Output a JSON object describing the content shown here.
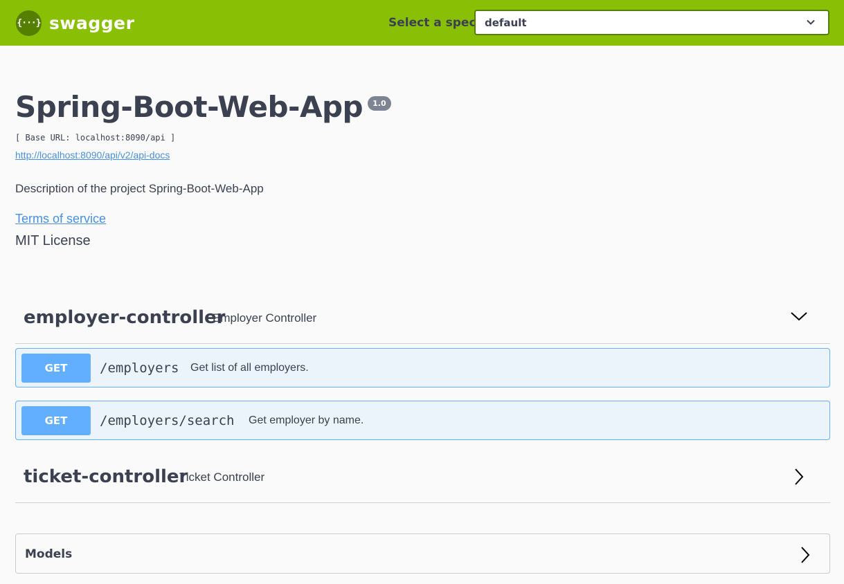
{
  "topbar": {
    "logo_glyph": "{···}",
    "logo_text": "swagger",
    "spec_label": "Select a spec",
    "spec_selected": "default"
  },
  "info": {
    "title": "Spring-Boot-Web-App",
    "version": "1.0",
    "base_url": "[ Base URL: localhost:8090/api ]",
    "api_docs_link": "http://localhost:8090/api/v2/api-docs",
    "description": "Description of the project Spring-Boot-Web-App",
    "terms_of_service": "Terms of service",
    "license": "MIT License"
  },
  "tags": [
    {
      "name": "employer-controller",
      "description": "Employer Controller",
      "expanded": true,
      "operations": [
        {
          "method": "GET",
          "path": "/employers",
          "summary": "Get list of all employers."
        },
        {
          "method": "GET",
          "path": "/employers/search",
          "summary": "Get employer by name."
        }
      ]
    },
    {
      "name": "ticket-controller",
      "description": "Ticket Controller",
      "expanded": false,
      "operations": []
    }
  ],
  "models": {
    "title": "Models"
  },
  "colors": {
    "topbar": "#89bf04",
    "logo_badge": "#547f00",
    "get_method": "#61affe",
    "get_bg": "#ebf3fb",
    "link": "#4990e2",
    "text": "#3b4151"
  },
  "icons": {
    "spec_select": "chevron-down-icon",
    "tag_expanded": "chevron-down-icon",
    "tag_collapsed": "chevron-right-icon",
    "models": "chevron-right-icon"
  }
}
